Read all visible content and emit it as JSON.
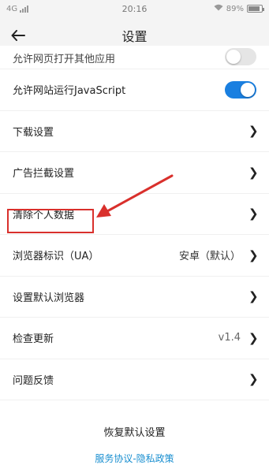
{
  "status_bar": {
    "network": "4G",
    "signal": "ull",
    "time": "20:16",
    "wifi_icon": "wifi-icon",
    "battery": "89%",
    "battery_level": 0.89
  },
  "header": {
    "title": "设置",
    "back_icon": "arrow-left-icon"
  },
  "settings": {
    "partial_item": {
      "label": "允许网页打开其他应用",
      "toggle_on": false
    },
    "allow_js": {
      "label": "允许网站运行JavaScript",
      "toggle_on": true
    },
    "download": {
      "label": "下载设置"
    },
    "adblock": {
      "label": "广告拦截设置"
    },
    "clear_data": {
      "label": "清除个人数据"
    },
    "ua": {
      "label": "浏览器标识（UA）",
      "value": "安卓（默认）"
    },
    "default_browser": {
      "label": "设置默认浏览器"
    },
    "update": {
      "label": "检查更新",
      "value": "v1.4"
    },
    "feedback": {
      "label": "问题反馈"
    }
  },
  "footer": {
    "reset_label": "恢复默认设置",
    "terms": "服务协议",
    "separator": "-",
    "privacy": "隐私政策"
  },
  "colors": {
    "accent": "#1a7fe0",
    "annotation": "#d9302c",
    "link": "#1a8fd0"
  }
}
